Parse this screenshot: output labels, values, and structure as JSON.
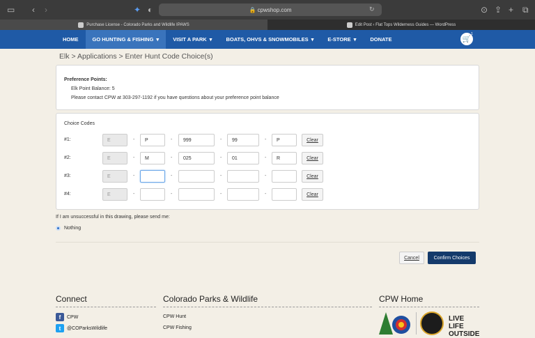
{
  "browser": {
    "url": "cpwshop.com",
    "tabs": [
      {
        "label": "Purchase License - Colorado Parks and Wildlife IPAWS"
      },
      {
        "label": "Edit Post ‹ Flat Tops Wilderness Guides — WordPress"
      }
    ]
  },
  "nav": {
    "items": [
      {
        "label": "HOME"
      },
      {
        "label": "GO HUNTING & FISHING"
      },
      {
        "label": "VISIT A PARK"
      },
      {
        "label": "BOATS, OHVS & SNOWMOBILES"
      },
      {
        "label": "E-STORE"
      },
      {
        "label": "DONATE"
      }
    ],
    "cart_count": "1"
  },
  "breadcrumb": "Elk  >  Applications  >  Enter Hunt Code Choice(s)",
  "preference": {
    "heading": "Preference Points:",
    "balance": "Elk Point Balance: 5",
    "contact": "Please contact CPW at 303-297-1192 if you have questions about your preference point balance"
  },
  "choices": {
    "heading": "Choice Codes",
    "clear_label": "Clear",
    "rows": [
      {
        "label": "#1:",
        "f1": "E",
        "f2": "P",
        "f3": "999",
        "f4": "99",
        "f5": "P"
      },
      {
        "label": "#2:",
        "f1": "E",
        "f2": "M",
        "f3": "025",
        "f4": "01",
        "f5": "R"
      },
      {
        "label": "#3:",
        "f1": "E",
        "f2": "",
        "f3": "",
        "f4": "",
        "f5": ""
      },
      {
        "label": "#4:",
        "f1": "E",
        "f2": "",
        "f3": "",
        "f4": "",
        "f5": ""
      }
    ]
  },
  "unsuccessful": {
    "prompt": "If I am unsuccessful in this drawing, please send me:",
    "option": "Nothing"
  },
  "buttons": {
    "cancel": "Cancel",
    "confirm": "Confirm Choices"
  },
  "footer": {
    "connect": {
      "title": "Connect",
      "links": [
        "CPW",
        "@COParksWildlife"
      ]
    },
    "cpw": {
      "title": "Colorado Parks & Wildlife",
      "links": [
        "CPW Hunt",
        "CPW Fishing"
      ]
    },
    "home": {
      "title": "CPW Home",
      "logo_text": "LIVE LIFE OUTSIDE"
    }
  },
  "colors": {
    "nav": "#1f5aa6",
    "confirm": "#143a6b",
    "background": "#f3efe6"
  }
}
